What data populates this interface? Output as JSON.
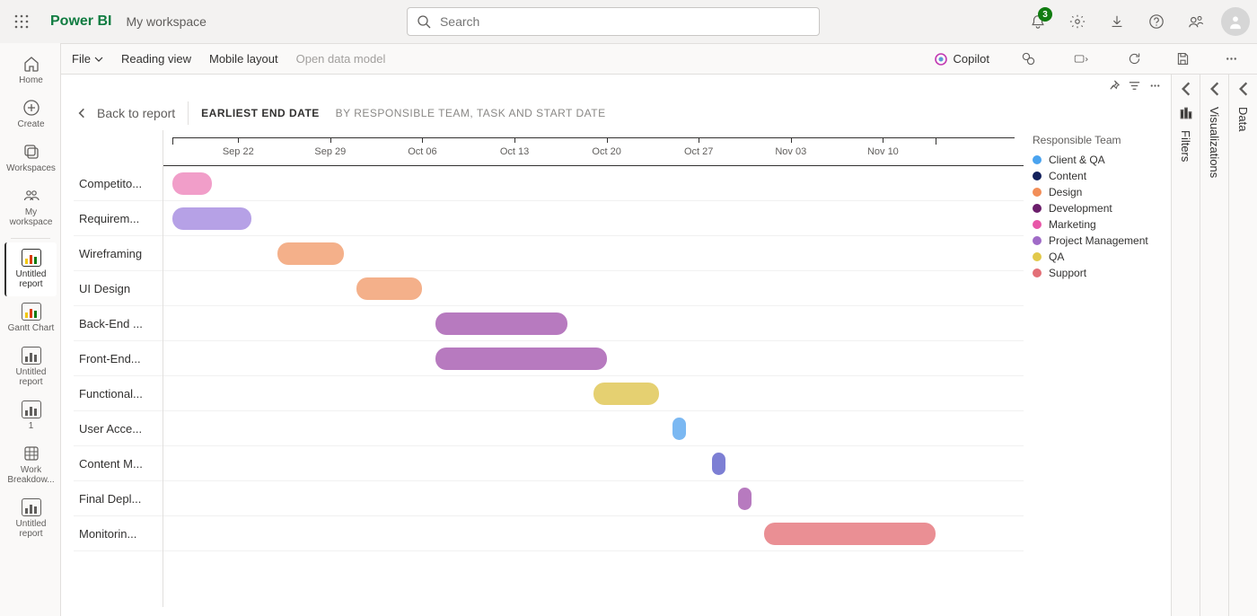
{
  "header": {
    "app": "Power BI",
    "workspace": "My workspace",
    "search_placeholder": "Search",
    "notif_count": "3"
  },
  "rail": {
    "home": "Home",
    "create": "Create",
    "workspaces": "Workspaces",
    "myws": "My workspace",
    "r1": "Untitled report",
    "r2": "Gantt Chart",
    "r3": "Untitled report",
    "r4": "1",
    "r5": "Work Breakdow...",
    "r6": "Untitled report"
  },
  "toolbar": {
    "file": "File",
    "reading": "Reading view",
    "mobile": "Mobile layout",
    "opendata": "Open data model",
    "copilot": "Copilot"
  },
  "visual": {
    "back": "Back to report",
    "title_bold": "Earliest End Date",
    "title_sub": "by Responsible Team, Task and Start Date",
    "legend_title": "Responsible Team"
  },
  "panes": {
    "filters": "Filters",
    "visualizations": "Visualizations",
    "data": "Data"
  },
  "legend": [
    {
      "label": "Client & QA",
      "color": "#4aa3ef"
    },
    {
      "label": "Content",
      "color": "#13215c"
    },
    {
      "label": "Design",
      "color": "#f28e58"
    },
    {
      "label": "Development",
      "color": "#6b1e6b"
    },
    {
      "label": "Marketing",
      "color": "#e857a8"
    },
    {
      "label": "Project Management",
      "color": "#a06bc7"
    },
    {
      "label": "QA",
      "color": "#e2c94a"
    },
    {
      "label": "Support",
      "color": "#e36f77"
    }
  ],
  "chart_data": {
    "type": "gantt",
    "title": "Earliest End Date by Responsible Team, Task and Start Date",
    "x_axis": {
      "range": [
        "2024-09-17",
        "2024-11-14"
      ],
      "ticks": [
        "Sep 22",
        "Sep 29",
        "Oct 06",
        "Oct 13",
        "Oct 20",
        "Oct 27",
        "Nov 03",
        "Nov 10"
      ]
    },
    "tasks": [
      {
        "label": "Competito...",
        "team": "Marketing",
        "color": "#f19ec9",
        "start": "2024-09-17",
        "end": "2024-09-20"
      },
      {
        "label": "Requirem...",
        "team": "Project Management",
        "color": "#b6a1e6",
        "start": "2024-09-17",
        "end": "2024-09-23"
      },
      {
        "label": "Wireframing",
        "team": "Design",
        "color": "#f4b08a",
        "start": "2024-09-25",
        "end": "2024-09-30"
      },
      {
        "label": "UI Design",
        "team": "Design",
        "color": "#f4b08a",
        "start": "2024-10-01",
        "end": "2024-10-06"
      },
      {
        "label": "Back-End ...",
        "team": "Development",
        "color": "#b77abf",
        "start": "2024-10-07",
        "end": "2024-10-17"
      },
      {
        "label": "Front-End...",
        "team": "Development",
        "color": "#b77abf",
        "start": "2024-10-07",
        "end": "2024-10-20"
      },
      {
        "label": "Functional...",
        "team": "QA",
        "color": "#e5d071",
        "start": "2024-10-19",
        "end": "2024-10-24"
      },
      {
        "label": "User Acce...",
        "team": "Client & QA",
        "color": "#7bb8f2",
        "start": "2024-10-25",
        "end": "2024-10-26"
      },
      {
        "label": "Content M...",
        "team": "Content",
        "color": "#7d7fd4",
        "start": "2024-10-28",
        "end": "2024-10-29"
      },
      {
        "label": "Final Depl...",
        "team": "Development",
        "color": "#b77abf",
        "start": "2024-10-30",
        "end": "2024-10-31"
      },
      {
        "label": "Monitorin...",
        "team": "Support",
        "color": "#ea8f94",
        "start": "2024-11-01",
        "end": "2024-11-14"
      }
    ]
  }
}
